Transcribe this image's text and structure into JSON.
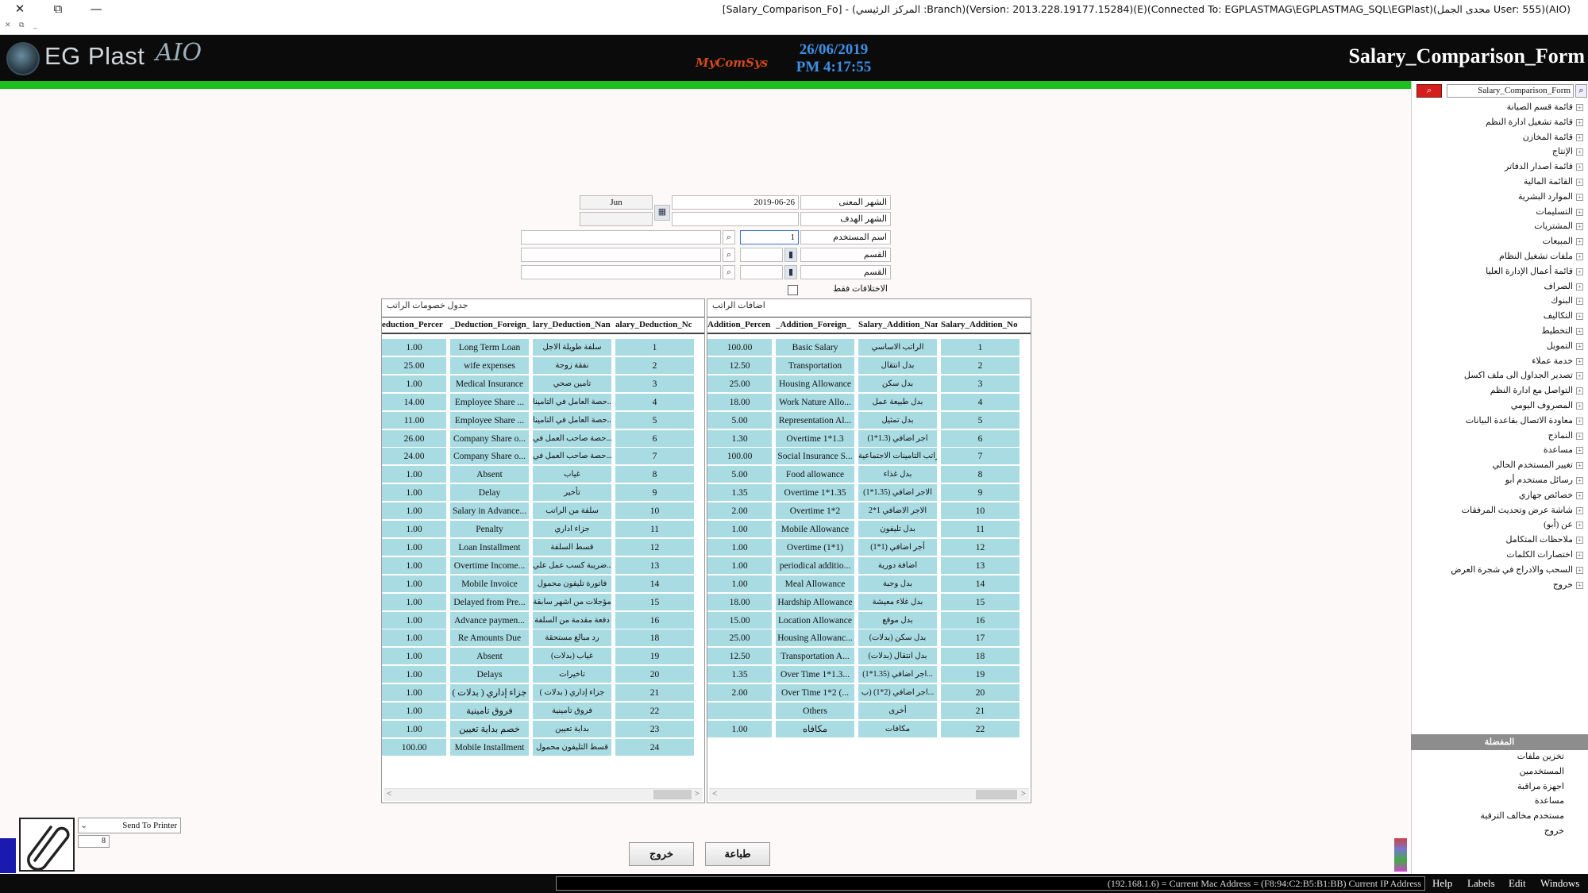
{
  "window": {
    "title": "[Salary_Comparison_Fo] - (المركز الرئيسي :Branch)(Version: 2013.228.19177.15284)(E)(Connected To: EGPLASTMAG\\EGPLASTMAG_SQL\\EGPlast)(مجدى الجمل User: 555)(AIO)",
    "close_glyph": "✕",
    "restore_glyph": "⧉",
    "min_glyph": "—",
    "sub_glyphs": [
      "✕",
      "⧉",
      "_"
    ]
  },
  "header": {
    "logo_text": "EG Plast",
    "logo_script": "AIO",
    "brand": "MyComSys",
    "date": "26/06/2019",
    "time": "PM 4:17:55",
    "form_title": "Salary_Comparison_Form"
  },
  "colors": {
    "header_bg": "#0b0b0b",
    "green_bar": "#1fbf1f",
    "row_bg": "#a9dbe2",
    "date_color": "#3f8fe6"
  },
  "form": {
    "month_label": "الشهر المعنى",
    "month_value": "2019-06-26",
    "month_name": "Jun",
    "target_label": "الشهر الهدف",
    "target_value": "",
    "target_name": "",
    "user_label": "اسم المستخدم",
    "user_code": "1",
    "user_name": "",
    "dept1_label": "القسم",
    "dept1_code": "",
    "dept1_name": "",
    "dept2_label": "القسم",
    "dept2_code": "",
    "dept2_name": "",
    "diff_only_label": "الاختلافات فقط"
  },
  "deductions": {
    "title": "جدول خصومات الراتب",
    "headers": [
      "eduction_Percer",
      "_Deduction_Foreign_",
      "lary_Deduction_Nan",
      "alary_Deduction_Nc"
    ],
    "rows": [
      [
        "1.00",
        "Long Term Loan",
        "سلفة طويلة الاجل",
        "1"
      ],
      [
        "25.00",
        "wife expenses",
        "نفقة زوجة",
        "2"
      ],
      [
        "1.00",
        "Medical Insurance",
        "تامين صحي",
        "3"
      ],
      [
        "14.00",
        "Employee Share ...",
        "حصة العامل في التامينا...",
        "4"
      ],
      [
        "11.00",
        "Employee Share ...",
        "حصة العامل في التامينا...",
        "5"
      ],
      [
        "26.00",
        "Company Share o...",
        "حصة صاحب العمل في...",
        "6"
      ],
      [
        "24.00",
        "Company Share o...",
        "حصة صاحب العمل في...",
        "7"
      ],
      [
        "1.00",
        "Absent",
        "غياب",
        "8"
      ],
      [
        "1.00",
        "Delay",
        "تأخير",
        "9"
      ],
      [
        "1.00",
        "Salary in Advance...",
        "سلفة من الراتب",
        "10"
      ],
      [
        "1.00",
        "Penalty",
        "جزاء اداري",
        "11"
      ],
      [
        "1.00",
        "Loan Installment",
        "قسط السلفة",
        "12"
      ],
      [
        "1.00",
        "Overtime Income...",
        "ضريبة كسب عمل علي...",
        "13"
      ],
      [
        "1.00",
        "Mobile Invoice",
        "فاتورة تليفون محمول",
        "14"
      ],
      [
        "1.00",
        "Delayed from Pre...",
        "مؤجلات من اشهر سابقة",
        "15"
      ],
      [
        "1.00",
        "Advance paymen...",
        "دفعة مقدمة من السلفة",
        "16"
      ],
      [
        "1.00",
        "Re Amounts Due",
        "رد مبالغ مستحقة",
        "18"
      ],
      [
        "1.00",
        "Absent",
        "غياب (بدلات)",
        "19"
      ],
      [
        "1.00",
        "Delays",
        "تاخيرات",
        "20"
      ],
      [
        "1.00",
        "جزاء إداري ( بدلات )",
        "جزاء إداري ( بدلات )",
        "21"
      ],
      [
        "1.00",
        "فروق تامينية",
        "فروق تامينية",
        "22"
      ],
      [
        "1.00",
        "خصم بداية تعيين",
        "بداية تعيين",
        "23"
      ],
      [
        "100.00",
        "Mobile Installment",
        "قسط التليفون محمول",
        "24"
      ]
    ]
  },
  "additions": {
    "title": "اضافات الراتب",
    "headers": [
      "Addition_Percen",
      "_Addition_Foreign_",
      "Salary_Addition_Nam",
      "Salary_Addition_No"
    ],
    "rows": [
      [
        "100.00",
        "Basic Salary",
        "الراتب الاساسي",
        "1"
      ],
      [
        "12.50",
        "Transportation",
        "بدل انتقال",
        "2"
      ],
      [
        "25.00",
        "Housing Allowance",
        "بدل سكن",
        "3"
      ],
      [
        "18.00",
        "Work Nature Allo...",
        "بدل طبيعة عمل",
        "4"
      ],
      [
        "5.00",
        "Representation Al...",
        "بدل تمثيل",
        "5"
      ],
      [
        "1.30",
        "Overtime 1*1.3",
        "اجر اضافي (1.3*1)",
        "6"
      ],
      [
        "100.00",
        "Social Insurance S...",
        "راتب التامينات الاجتماعية",
        "7"
      ],
      [
        "5.00",
        "Food allowance",
        "بدل غذاء",
        "8"
      ],
      [
        "1.35",
        "Overtime 1*1.35",
        "الاجر اضافي (1.35*1)",
        "9"
      ],
      [
        "2.00",
        "Overtime 1*2",
        "الاجر الاضافي 1*2",
        "10"
      ],
      [
        "1.00",
        "Mobile Allowance",
        "بدل تليفون",
        "11"
      ],
      [
        "1.00",
        "Overtime (1*1)",
        "أجر اضافي (1*1)",
        "12"
      ],
      [
        "1.00",
        "periodical additio...",
        "اضافة دورية",
        "13"
      ],
      [
        "1.00",
        "Meal Allowance",
        "بدل وجبة",
        "14"
      ],
      [
        "18.00",
        "Hardship Allowance",
        "بدل غلاء معيشة",
        "15"
      ],
      [
        "15.00",
        "Location Allowance",
        "بدل موقع",
        "16"
      ],
      [
        "25.00",
        "Housing Allowanc...",
        "بدل سكن (بدلات)",
        "17"
      ],
      [
        "12.50",
        "Transportation A...",
        "بدل انتقال (بدلات)",
        "18"
      ],
      [
        "1.35",
        "Over Time 1*1.3...",
        "اجر اضافي (1.35*1)...",
        "19"
      ],
      [
        "2.00",
        "Over Time 1*2 (...",
        "اجر اضافي (2*1) (ب...",
        "20"
      ],
      [
        "",
        "Others",
        "أخرى",
        "21"
      ],
      [
        "1.00",
        "مكافاه",
        "مكافات",
        "22"
      ]
    ]
  },
  "buttons": {
    "exit": "خروج",
    "print": "طباعة"
  },
  "printer": {
    "option": "Send To Printer",
    "copies": "8"
  },
  "sidebar": {
    "search_value": "Salary_Comparison_Form",
    "items": [
      "قائمة قسم الصيانة",
      "قائمة تشغيل ادارة النظم",
      "قائمة المخازن",
      "الإنتاج",
      "قائمة اصدار الدفاتر",
      "القائمة المالية",
      "الموارد البشرية",
      "التسليمات",
      "المشتريات",
      "المبيعات",
      "ملفات تشغيل النظام",
      "قائمة أعمال الإدارة العليا",
      "الصراف",
      "البنوك",
      "التكاليف",
      "التخطيط",
      "التمويل",
      "خدمة عملاء",
      "تصدير الجداول الى ملف اكسل",
      "التواصل مع ادارة النظم",
      "المصروف اليومي",
      "معاودة الاتصال بقاعدة البيانات",
      "النماذج",
      "مساعدة",
      "تغيير المستخدم الحالي",
      "رسائل مستخدم أبو",
      "خصائص جهازي",
      "شاشة عرض وتحديث المرفقات",
      "عن (أبو)",
      "ملاحظات المتكامل",
      "اختصارات الكلمات",
      "السحب والادراج في شجرة العرض",
      "خروج"
    ],
    "favorites_title": "المفضلة",
    "favorites": [
      "تخزين ملفات",
      "المستخدمين",
      "اجهزة مراقبة",
      "مساعدة",
      "مستخدم مخالف الترقية",
      "خروج"
    ]
  },
  "statusbar": {
    "info": "(192.168.1.6) = Current Mac Address = (F8:94:C2:B5:B1:BB) Current IP Address",
    "menu": [
      "Help",
      "Labels",
      "Edit",
      "Windows"
    ]
  }
}
